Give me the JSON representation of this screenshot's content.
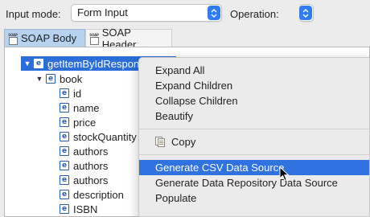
{
  "toolbar": {
    "input_mode_label": "Input mode:",
    "input_mode_value": "Form Input",
    "operation_label": "Operation:",
    "operation_value": ""
  },
  "tabs": [
    {
      "label": "SOAP Body",
      "icon": "soap-icon",
      "active": true
    },
    {
      "label": "SOAP Header",
      "icon": "soap-icon",
      "active": false
    }
  ],
  "soap_icon_text": "SOAP",
  "tree": {
    "root": {
      "label": "getItemByIdRespon",
      "icon": "element-icon"
    },
    "book": {
      "label": "book",
      "icon": "element-icon"
    },
    "icon_letter": "e",
    "leaves": [
      "id",
      "name",
      "price",
      "stockQuantity",
      "authors",
      "authors",
      "authors",
      "description",
      "ISBN"
    ]
  },
  "context_menu": {
    "group1": [
      "Expand All",
      "Expand Children",
      "Collapse Children",
      "Beautify"
    ],
    "copy": "Copy",
    "group2": [
      "Generate CSV Data Source",
      "Generate Data Repository Data Source",
      "Populate"
    ],
    "highlighted": "Generate CSV Data Source"
  },
  "colors": {
    "selection": "#2b6ed8",
    "menu_highlight": "#2f72e0",
    "tab_active": "#b6d2ee",
    "stepper": "#2f7cf6"
  }
}
